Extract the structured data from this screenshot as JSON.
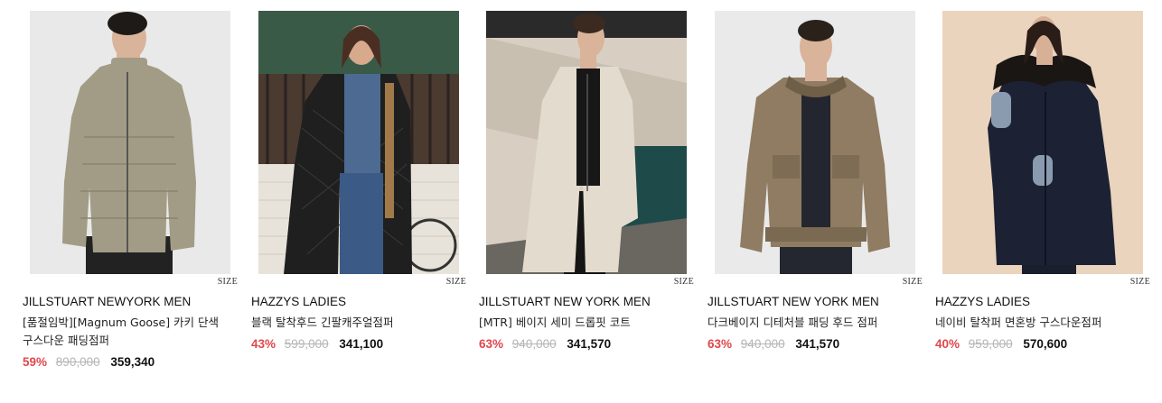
{
  "products": [
    {
      "brand": "JILLSTUART NEWYORK MEN",
      "name": "[품절임박][Magnum Goose] 카키 단색 구스다운 패딩점퍼",
      "discount": "59%",
      "original_price": "890,000",
      "price": "359,340",
      "size_label": "SIZE",
      "colors": {
        "bg": "#e9e9e9",
        "garment": "#a29c87",
        "hair": "#1e1a17",
        "skin": "#d9b39a",
        "pants": "#222222"
      }
    },
    {
      "brand": "HAZZYS LADIES",
      "name": "블랙 탈착후드 긴팔캐주얼점퍼",
      "discount": "43%",
      "original_price": "599,000",
      "price": "341,100",
      "size_label": "SIZE",
      "colors": {
        "bg": "#2f4a3c",
        "garment": "#1f1f20",
        "hair": "#4a2e22",
        "skin": "#d7aa8d",
        "pants": "#3b5b86"
      }
    },
    {
      "brand": "JILLSTUART NEW YORK MEN",
      "name": "[MTR] 베이지 세미 드롭핏 코트",
      "discount": "63%",
      "original_price": "940,000",
      "price": "341,570",
      "size_label": "SIZE",
      "colors": {
        "bg": "#d8cfc2",
        "garment": "#e3dbcd",
        "hair": "#3a2a20",
        "skin": "#d9b39a",
        "pants": "#151515"
      }
    },
    {
      "brand": "JILLSTUART NEW YORK MEN",
      "name": "다크베이지 디테처블 패딩 후드 점퍼",
      "discount": "63%",
      "original_price": "940,000",
      "price": "341,570",
      "size_label": "SIZE",
      "colors": {
        "bg": "#eaeaea",
        "garment": "#8f7c62",
        "hair": "#2a211b",
        "skin": "#d9b39a",
        "pants": "#252730"
      }
    },
    {
      "brand": "HAZZYS LADIES",
      "name": "네이비 탈착퍼 면혼방 구스다운점퍼",
      "discount": "40%",
      "original_price": "959,000",
      "price": "570,600",
      "size_label": "SIZE",
      "colors": {
        "bg": "#ead4bd",
        "garment": "#1c2233",
        "hair": "#2a1d17",
        "skin": "#d8b096",
        "pants": "#1a1f2d"
      }
    }
  ]
}
